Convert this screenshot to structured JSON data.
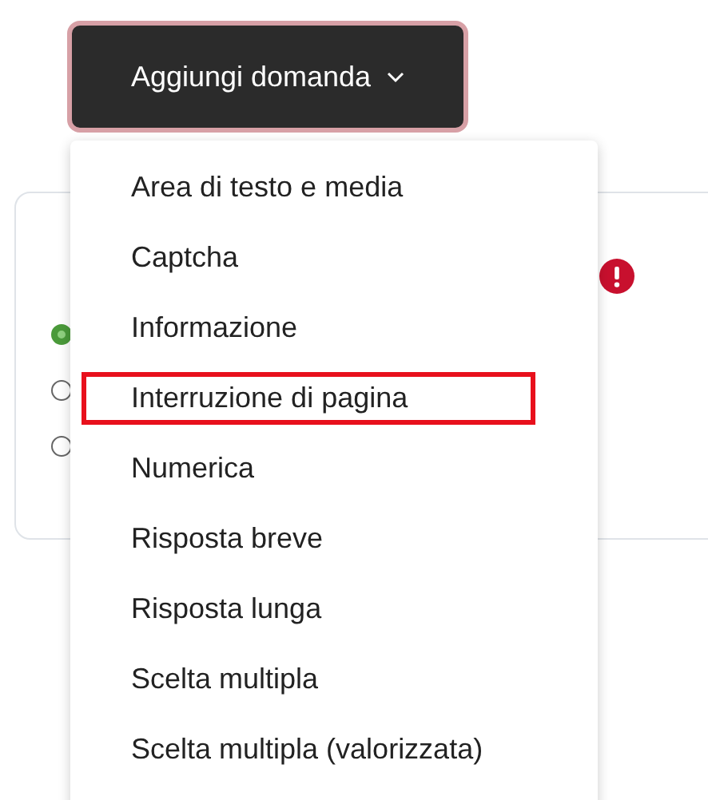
{
  "add_button": {
    "label": "Aggiungi domanda"
  },
  "question_card": {
    "error": true,
    "radios": [
      {
        "selected": true
      },
      {
        "selected": false
      },
      {
        "selected": false
      }
    ]
  },
  "menu": {
    "items": [
      {
        "label": "Area di testo e media",
        "highlighted": false
      },
      {
        "label": "Captcha",
        "highlighted": false
      },
      {
        "label": "Informazione",
        "highlighted": false
      },
      {
        "label": "Interruzione di pagina",
        "highlighted": true
      },
      {
        "label": "Numerica",
        "highlighted": false
      },
      {
        "label": "Risposta breve",
        "highlighted": false
      },
      {
        "label": "Risposta lunga",
        "highlighted": false
      },
      {
        "label": "Scelta multipla",
        "highlighted": false
      },
      {
        "label": "Scelta multipla (valorizzata)",
        "highlighted": false
      }
    ]
  }
}
